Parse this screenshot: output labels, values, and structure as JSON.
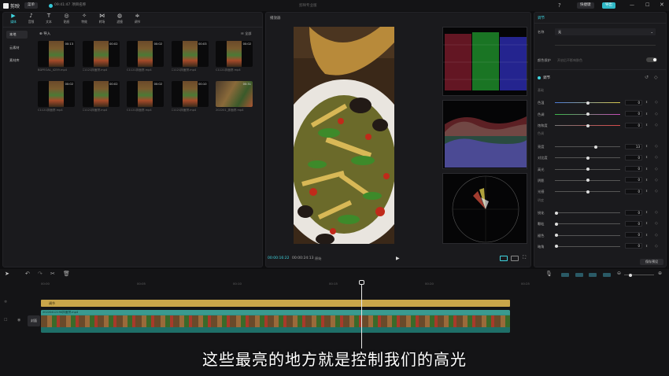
{
  "app": {
    "name": "剪映",
    "menu_label": "菜单",
    "project_time": "09:41:47",
    "project_name": "项目名称",
    "center_title": "剪映专业版"
  },
  "topbar": {
    "shortcuts_label": "快捷键",
    "export_label": "导出"
  },
  "toolbar": {
    "tools": [
      {
        "label": "媒体",
        "icon": "▶"
      },
      {
        "label": "音频",
        "icon": "♪"
      },
      {
        "label": "文本",
        "icon": "T"
      },
      {
        "label": "贴纸",
        "icon": "◎"
      },
      {
        "label": "特效",
        "icon": "✧"
      },
      {
        "label": "转场",
        "icon": "⋈"
      },
      {
        "label": "滤镜",
        "icon": "◍"
      },
      {
        "label": "调节",
        "icon": "≑"
      }
    ]
  },
  "media": {
    "sidebar": [
      "本地",
      "云素材",
      "素材库"
    ],
    "import_label": "导入",
    "sort_label": "全部",
    "items": [
      {
        "name": "BDPEOAL_4259.mp4",
        "dur": "00:13"
      },
      {
        "name": "C1121拌面饼.mp4",
        "dur": "00:02"
      },
      {
        "name": "C1121拌面饼.mp4",
        "dur": "00:02"
      },
      {
        "name": "C1121拌面饼.mp4",
        "dur": "00:03"
      },
      {
        "name": "C1121拌面饼.mp4",
        "dur": "00:02"
      },
      {
        "name": "C1121拌面饼.mp4",
        "dur": "00:02"
      },
      {
        "name": "C1121拌面饼.mp4",
        "dur": "00:02"
      },
      {
        "name": "C1121拌面饼.mp4",
        "dur": "00:02"
      },
      {
        "name": "C1121拌面饼.mp4",
        "dur": "00:10"
      },
      {
        "name": "202201_拌面饼.mp4",
        "dur": "00:31"
      }
    ]
  },
  "player": {
    "title": "播放器",
    "current_time": "00:00:16:22",
    "total_time": "00:00:24:13",
    "ratio_label": "原始"
  },
  "right": {
    "tab": "调节",
    "field_label": "名称",
    "field_value": "无",
    "preset_label": "颜色保护",
    "preset_hint": "开启后不影响肤色",
    "section": "调节",
    "sub1": "基础",
    "sub2": "色调",
    "sub3": "明度",
    "sliders_a": [
      {
        "label": "色温",
        "value": "0"
      },
      {
        "label": "色调",
        "value": "0"
      },
      {
        "label": "饱和度",
        "value": "0"
      }
    ],
    "sliders_b": [
      {
        "label": "亮度",
        "value": "13"
      },
      {
        "label": "对比度",
        "value": "0"
      },
      {
        "label": "高光",
        "value": "0"
      },
      {
        "label": "阴影",
        "value": "0"
      },
      {
        "label": "光感",
        "value": "0"
      }
    ],
    "sliders_c": [
      {
        "label": "锐化",
        "value": "0"
      },
      {
        "label": "颗粒",
        "value": "0"
      },
      {
        "label": "褪色",
        "value": "0"
      },
      {
        "label": "暗角",
        "value": "0"
      }
    ],
    "save_label": "保存预设"
  },
  "timeline": {
    "ruler": [
      "00:00",
      "00:05",
      "00:10",
      "00:15",
      "00:20",
      "00:25"
    ],
    "adjust_label": "调节",
    "cover_label": "封面",
    "clip_label": "20220412190拌面饼.mp4"
  },
  "subtitle": "这些最亮的地方就是控制我们的高光",
  "colors": {
    "accent": "#3fd5e0",
    "adjust_clip": "#c9a64a",
    "video_clip": "#2f8f86"
  }
}
